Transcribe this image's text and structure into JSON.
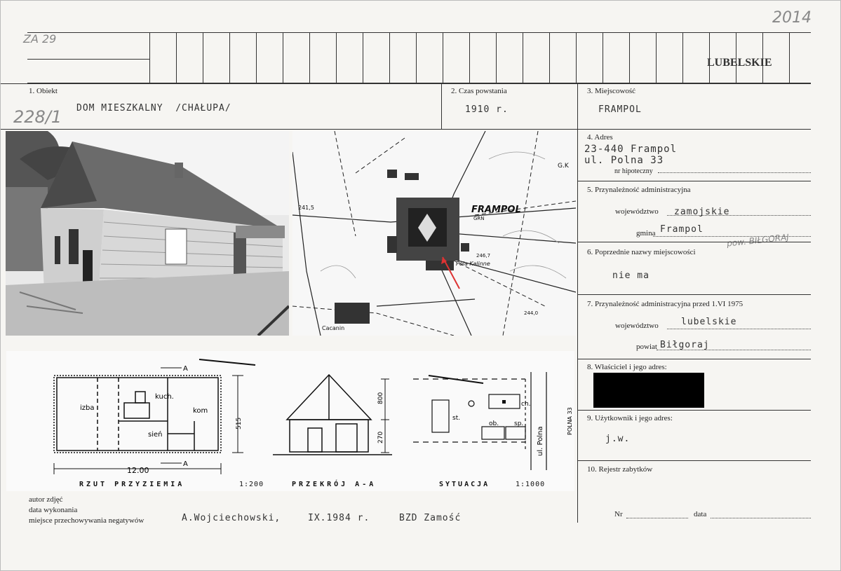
{
  "header": {
    "index_code": "ZA 29",
    "year_note": "2014",
    "inventory_number": "228/1",
    "region": "LUBELSKIE"
  },
  "fields": {
    "f1_label": "1. Obiekt",
    "f1_value": "DOM MIESZKALNY  /CHAŁUPA/",
    "f2_label": "2. Czas powstania",
    "f2_value": "1910 r.",
    "f3_label": "3. Miejscowość",
    "f3_value": "FRAMPOL",
    "f4_label": "4. Adres",
    "f4_line1": "23-440 Frampol",
    "f4_line2": "ul. Polna 33",
    "f4_mortgage_label": "nr hipoteczny",
    "f5_label": "5. Przynależność administracyjna",
    "f5_voiv_label": "województwo",
    "f5_voiv_value": "zamojskie",
    "f5_gmina_label": "gmina",
    "f5_gmina_value": "Frampol",
    "f5_note": "pow. BIŁGORAJ",
    "f6_label": "6. Poprzednie nazwy miejscowości",
    "f6_value": "nie ma",
    "f7_label": "7. Przynależność administracyjna przed 1.VI 1975",
    "f7_voiv_label": "województwo",
    "f7_voiv_value": "lubelskie",
    "f7_powiat_label": "powiat",
    "f7_powiat_value": "Biłgoraj",
    "f8_label": "8. Właściciel i jego adres:",
    "f9_label": "9. Użytkownik i jego adres:",
    "f9_value": "j.w.",
    "f10_label": "10. Rejestr zabytków",
    "nr_label": "Nr",
    "data_label": "data"
  },
  "map": {
    "town": "FRAMPOL",
    "grn": "GRN",
    "gk": "G.K",
    "field_name": "Pola Kalinne",
    "elev1": "241,5",
    "elev2": "246,7",
    "elev3": "244,0",
    "village": "Cacanin"
  },
  "drawings": {
    "plan_izba": "izba",
    "plan_kuch": "kuch.",
    "plan_kom": "kom",
    "plan_sien": "sień",
    "plan_len": "12.00",
    "plan_width": "515",
    "section_h1": "800",
    "section_h2": "270",
    "sit_ch": "ch.",
    "sit_st": "st.",
    "sit_ob": "ob.",
    "sit_sp": "sp.",
    "sit_street": "ul. Polna",
    "sit_no": "POLNA 33",
    "mark_a": "A",
    "caption_plan": "RZUT PRZYZIEMIA",
    "caption_plan_scale": "1:200",
    "caption_section": "PRZEKRÓJ A-A",
    "caption_site": "SYTUACJA",
    "caption_site_scale": "1:1000"
  },
  "footer": {
    "author_label": "autor zdjęć",
    "date_label": "data wykonania",
    "storage_label": "miejsce przechowywania negatywów",
    "author_value": "A.Wojciechowski,",
    "date_value": "IX.1984 r.",
    "storage_value": "BZD Zamość"
  }
}
